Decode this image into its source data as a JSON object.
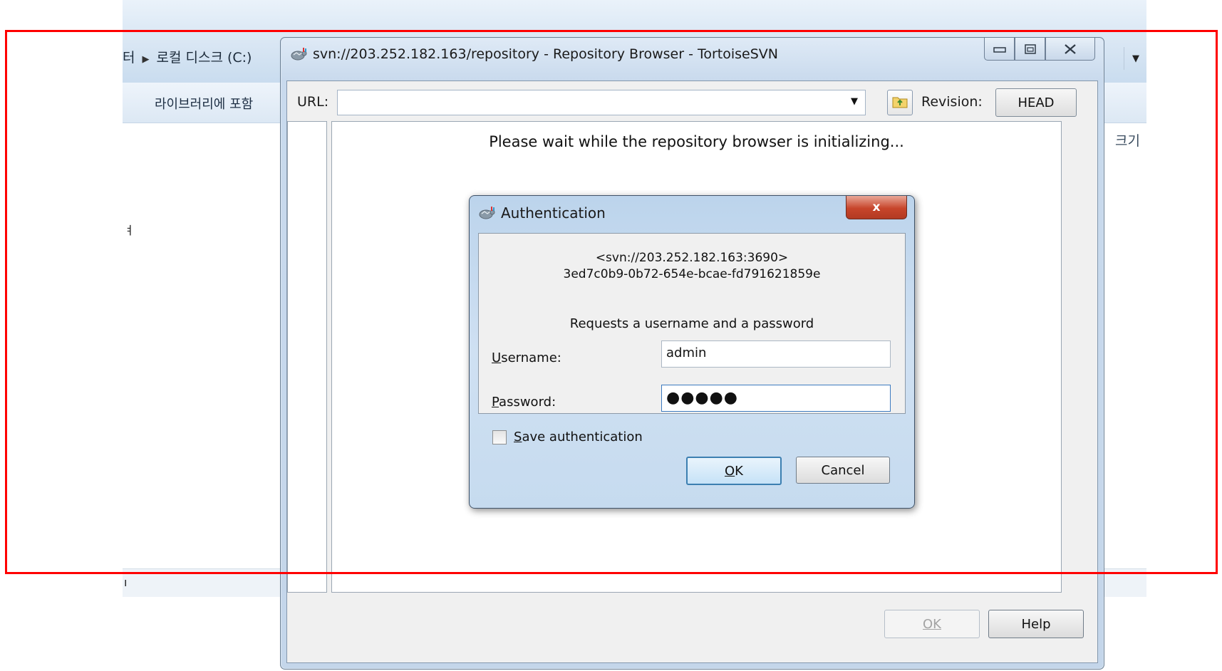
{
  "explorer": {
    "breadcrumb_prefix": "터",
    "breadcrumb_item": "로컬 디스크 (C:)",
    "library_button": "라이브러리에 포함",
    "column_size": "크기",
    "left_fragment": "ㅕ",
    "left_fragment_bottom": "ı"
  },
  "repo_browser": {
    "title": "svn://203.252.182.163/repository - Repository Browser - TortoiseSVN",
    "url_label": "URL:",
    "url_value": "",
    "revision_label": "Revision:",
    "revision_button": "HEAD",
    "wait_message": "Please wait while the repository browser is initializing...",
    "ok_button": "OK",
    "help_button": "Help"
  },
  "auth_dialog": {
    "title": "Authentication",
    "close_label": "x",
    "realm_line1": "<svn://203.252.182.163:3690>",
    "realm_line2": "3ed7c0b9-0b72-654e-bcae-fd791621859e",
    "prompt": "Requests a username and a password",
    "username_label_u": "U",
    "username_label_rest": "sername:",
    "username_value": "admin",
    "password_label_u": "P",
    "password_label_rest": "assword:",
    "password_masked": "●●●●●",
    "save_auth_u": "S",
    "save_auth_rest": "ave authentication",
    "save_auth_checked": false,
    "ok_u": "O",
    "ok_rest": "K",
    "cancel_button": "Cancel"
  },
  "colors": {
    "highlight": "#ff0000",
    "window_frame": "#c9daed",
    "close_button": "#c7452b"
  }
}
